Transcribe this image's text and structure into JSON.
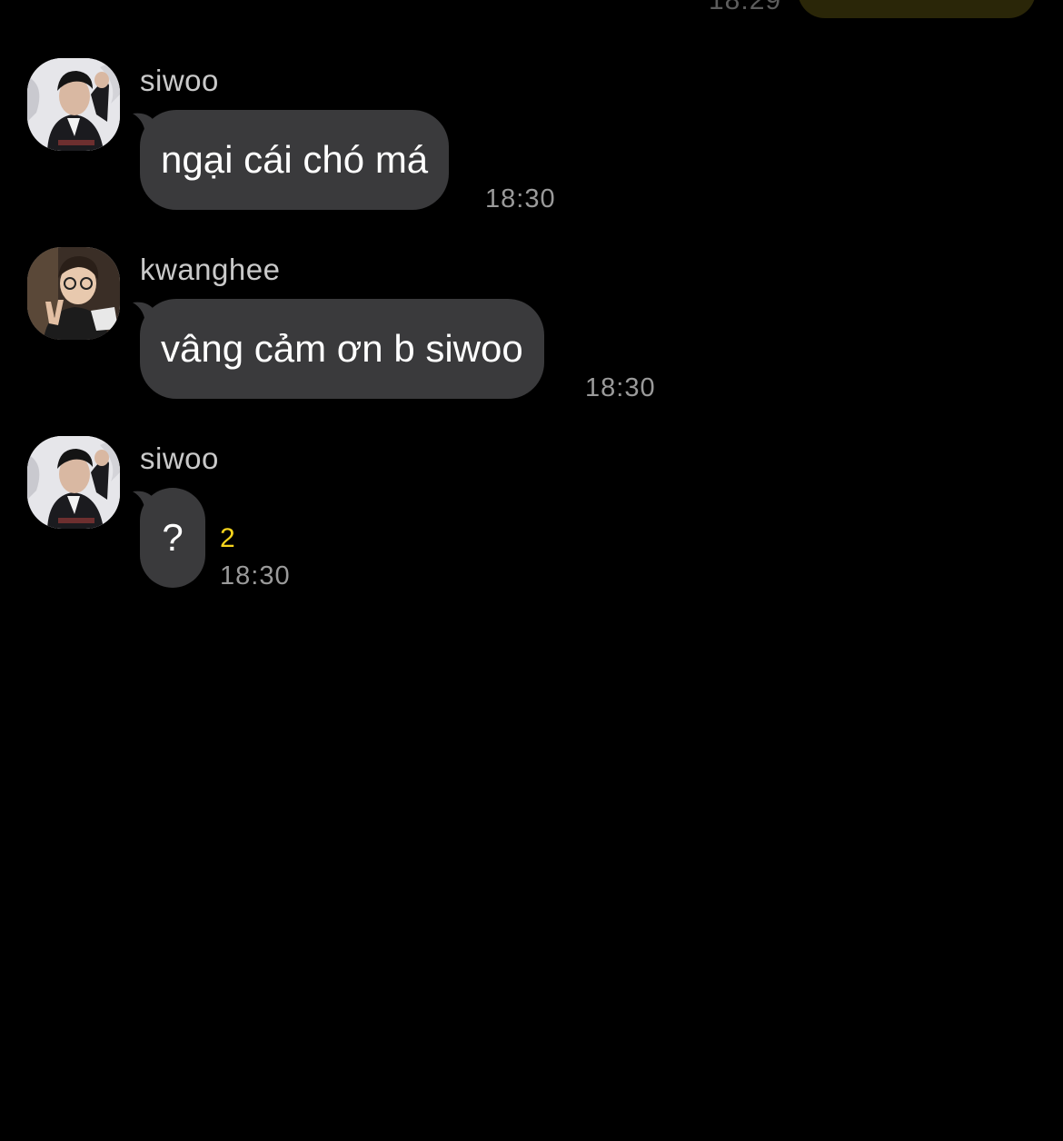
{
  "top_partial": {
    "time": "18:29"
  },
  "messages": [
    {
      "sender": "siwoo",
      "avatar": "siwoo-avatar",
      "text": "ngại cái chó má",
      "time": "18:30"
    },
    {
      "sender": "kwanghee",
      "avatar": "kwanghee-avatar",
      "text": "vâng cảm ơn b siwoo",
      "time": "18:30"
    },
    {
      "sender": "siwoo",
      "avatar": "siwoo-avatar",
      "text": "?",
      "time": "18:30",
      "unread_count": "2"
    }
  ],
  "colors": {
    "background": "#000000",
    "bubble": "#3a3a3c",
    "unread": "#f7d51d",
    "outgoing_bubble": "#f7d51d"
  }
}
